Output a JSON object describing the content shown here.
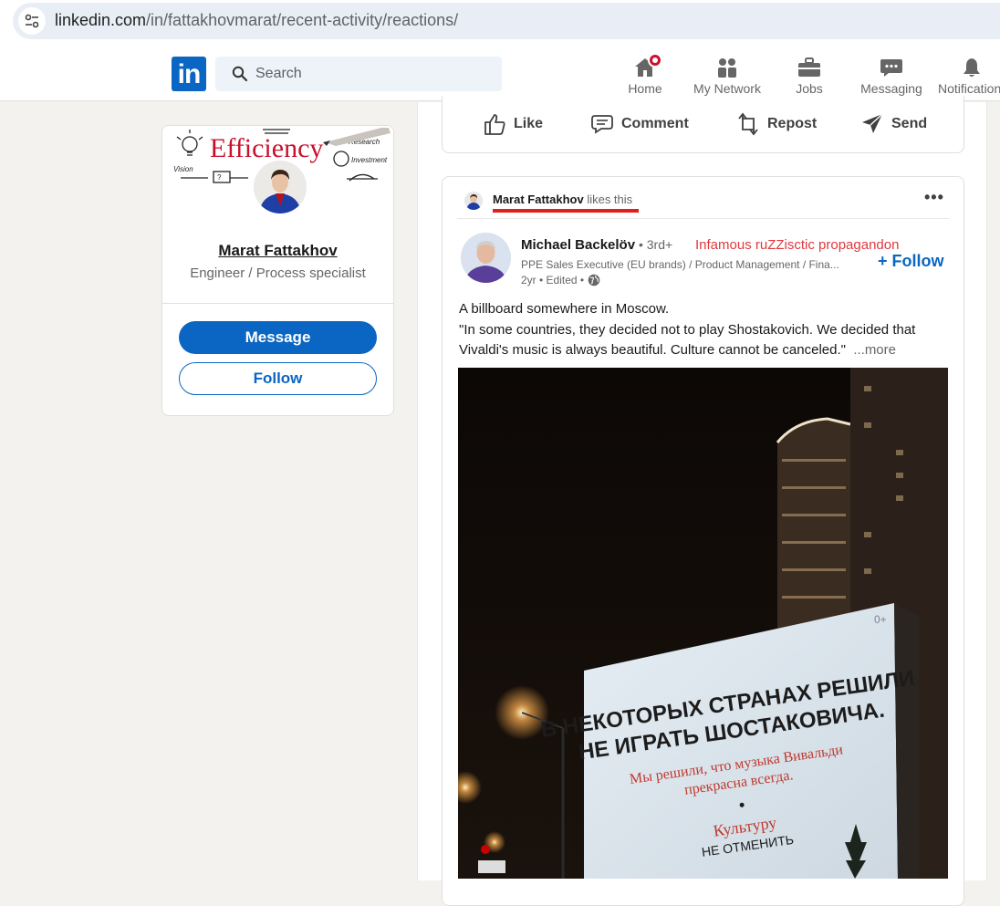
{
  "browser": {
    "url_host": "linkedin.com",
    "url_path": "/in/fattakhovmarat/recent-activity/reactions/"
  },
  "nav": {
    "logo": "in",
    "search_placeholder": "Search",
    "items": [
      {
        "label": "Home",
        "icon": "home-icon"
      },
      {
        "label": "My Network",
        "icon": "network-icon"
      },
      {
        "label": "Jobs",
        "icon": "briefcase-icon"
      },
      {
        "label": "Messaging",
        "icon": "chat-icon"
      },
      {
        "label": "Notifications",
        "icon": "bell-icon"
      }
    ]
  },
  "profile": {
    "name": "Marat Fattakhov",
    "title": "Engineer / Process specialist",
    "message_label": "Message",
    "follow_label": "Follow",
    "cover_words": {
      "big": "Efficiency",
      "research": "Research",
      "investment": "Investment",
      "vision": "Vision",
      "q": "?"
    }
  },
  "actions": {
    "like": "Like",
    "comment": "Comment",
    "repost": "Repost",
    "send": "Send"
  },
  "post": {
    "context_name": "Marat Fattakhov",
    "context_suffix": " likes this",
    "author_name": "Michael Backelöv",
    "author_degree": " • 3rd+",
    "red_tag": "Infamous ruZZisctic propagandon",
    "author_headline": "PPE Sales Executive (EU brands) / Product Management / Fina...",
    "time": "2yr • Edited •",
    "follow_label": "+ Follow",
    "text_line1": "A billboard somewhere in Moscow.",
    "text_line2": "\"In some countries, they decided not to play Shostakovich. We decided that Vivaldi's music is always beautiful. Culture cannot be canceled.\"",
    "more_label": "...more",
    "billboard": {
      "line1": "В НЕКОТОРЫХ СТРАНАХ РЕШИЛИ",
      "line2": "НЕ ИГРАТЬ ШОСТАКОВИЧА.",
      "red1": "Мы решили, что музыка Вивальди",
      "red2": "прекрасна всегда.",
      "culture": "Культуру",
      "cannot": "НЕ ОТМЕНИТЬ",
      "age": "0+"
    }
  }
}
